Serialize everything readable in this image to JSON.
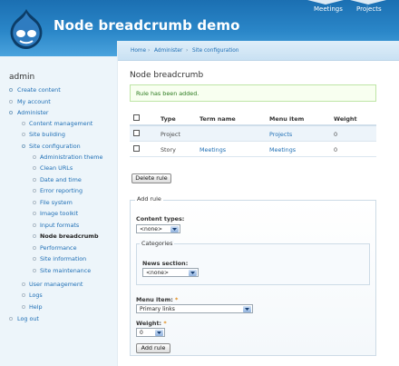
{
  "site": {
    "name": "Node breadcrumb demo",
    "primary_links": [
      "Meetings",
      "Projects"
    ]
  },
  "sidebar": {
    "title": "admin",
    "items": [
      {
        "label": "Create content",
        "level": 0
      },
      {
        "label": "My account",
        "level": 0
      },
      {
        "label": "Administer",
        "level": 0
      },
      {
        "label": "Content management",
        "level": 1
      },
      {
        "label": "Site building",
        "level": 1
      },
      {
        "label": "Site configuration",
        "level": 1
      },
      {
        "label": "Administration theme",
        "level": 2
      },
      {
        "label": "Clean URLs",
        "level": 2
      },
      {
        "label": "Date and time",
        "level": 2
      },
      {
        "label": "Error reporting",
        "level": 2
      },
      {
        "label": "File system",
        "level": 2
      },
      {
        "label": "Image toolkit",
        "level": 2
      },
      {
        "label": "Input formats",
        "level": 2
      },
      {
        "label": "Node breadcrumb",
        "level": 2,
        "active": true
      },
      {
        "label": "Performance",
        "level": 2
      },
      {
        "label": "Site information",
        "level": 2
      },
      {
        "label": "Site maintenance",
        "level": 2
      },
      {
        "label": "User management",
        "level": 1
      },
      {
        "label": "Logs",
        "level": 1
      },
      {
        "label": "Help",
        "level": 1
      },
      {
        "label": "Log out",
        "level": 0
      }
    ]
  },
  "breadcrumb": {
    "items": [
      "Home",
      "Administer",
      "Site configuration"
    ],
    "separator": "›"
  },
  "page": {
    "title": "Node breadcrumb",
    "status_message": "Rule has been added."
  },
  "rules_table": {
    "headers": [
      "Type",
      "Term name",
      "Menu item",
      "Weight"
    ],
    "rows": [
      {
        "type": "Project",
        "term_name": "",
        "menu_item": "Projects",
        "weight": "0"
      },
      {
        "type": "Story",
        "term_name": "Meetings",
        "menu_item": "Meetings",
        "weight": "0"
      }
    ]
  },
  "buttons": {
    "delete_rule": "Delete rule",
    "add_rule": "Add rule"
  },
  "add_rule_form": {
    "legend": "Add rule",
    "content_types_label": "Content types:",
    "content_types_value": "<none>",
    "categories_legend": "Categories",
    "news_section_label": "News section:",
    "news_section_value": "<none>",
    "menu_item_label": "Menu item:",
    "menu_item_value": "Primary links",
    "weight_label": "Weight:",
    "weight_value": "0",
    "required_mark": "*"
  },
  "colors": {
    "header_blue": "#2a86c8",
    "link_blue": "#1f6fb5",
    "status_green": "#2b7a1e",
    "required_orange": "#e08a16"
  }
}
